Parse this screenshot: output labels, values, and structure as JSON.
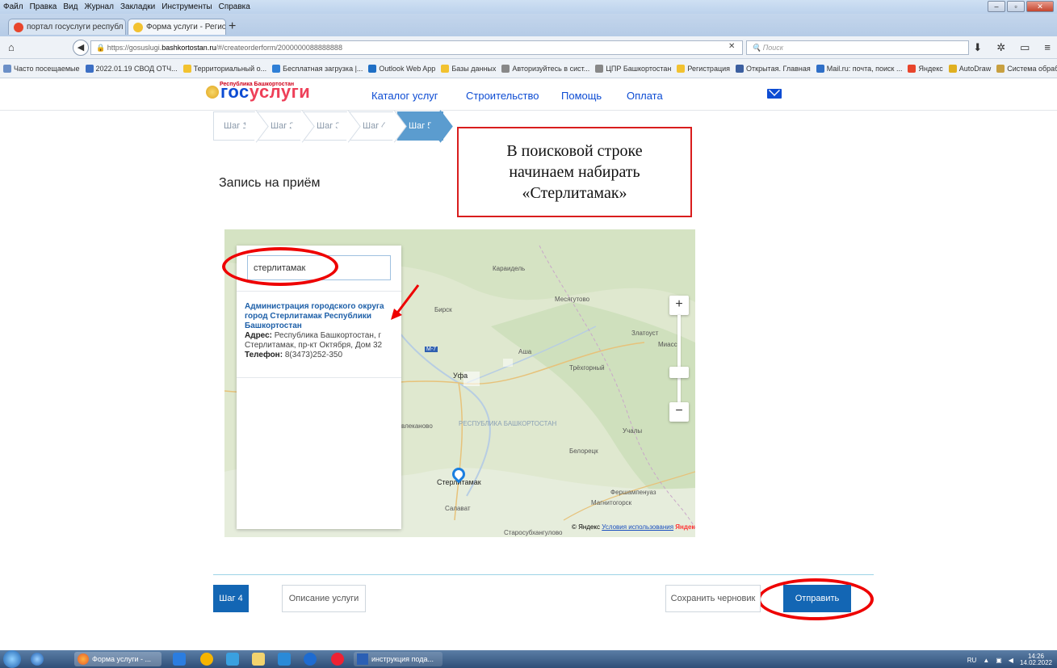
{
  "browser": {
    "menu": [
      "Файл",
      "Правка",
      "Вид",
      "Журнал",
      "Закладки",
      "Инструменты",
      "Справка"
    ],
    "tabs": [
      {
        "label": "портал госуслуги республ",
        "active": false,
        "favicon_color": "#e8452c"
      },
      {
        "label": "Форма услуги - Региональ",
        "active": true,
        "favicon_color": "#f2c230"
      }
    ],
    "url_prefix": "https://gosuslugi.",
    "url_domain": "bashkortostan.ru",
    "url_path": "/#/createorderform/2000000088888888",
    "search_placeholder": "Поиск",
    "bookmarks": [
      {
        "label": "Часто посещаемые",
        "color": "#6b8fc7"
      },
      {
        "label": "2022.01.19 СВОД ОТЧ...",
        "color": "#3c6fc4"
      },
      {
        "label": "Территориальный о...",
        "color": "#f2c230"
      },
      {
        "label": "Бесплатная загрузка |...",
        "color": "#2f7fd6"
      },
      {
        "label": "Outlook Web App",
        "color": "#1f6fc5"
      },
      {
        "label": "Базы данных",
        "color": "#f2c230"
      },
      {
        "label": "Авторизуйтесь в сист...",
        "color": "#888888"
      },
      {
        "label": "ЦПР Башкортостан",
        "color": "#888888"
      },
      {
        "label": "Регистрация",
        "color": "#f2c230"
      },
      {
        "label": "Открытая. Главная",
        "color": "#3b5fa0"
      },
      {
        "label": "Mail.ru: почта, поиск ...",
        "color": "#2f6fc7"
      },
      {
        "label": "Яндекс",
        "color": "#e8452c"
      },
      {
        "label": "AutoDraw",
        "color": "#e0b020"
      },
      {
        "label": "Система обработки з...",
        "color": "#c8a040"
      }
    ]
  },
  "site": {
    "logo_small": "Республика Башкортостан",
    "logo_main_a": "гос",
    "logo_main_b": "услуги",
    "nav": [
      "Каталог услуг",
      "Строительство",
      "Помощь",
      "Оплата"
    ],
    "steps": [
      "Шаг 1",
      "Шаг 2",
      "Шаг 3",
      "Шаг 4",
      "Шаг 5"
    ],
    "active_step": 5,
    "heading": "Запись на приём"
  },
  "callout": {
    "lines": [
      "В поисковой строке",
      "начинаем набирать",
      "«Стерлитамак»"
    ]
  },
  "map": {
    "search_value": "стерлитамак",
    "result_title": "Администрация городского округа город Стерлитамак Республики Башкортостан",
    "address_label": "Адрес:",
    "address_value": " Республика Башкортостан, г Стерлитамак, пр-кт Октября, Дом 32",
    "phone_label": "Телефон:",
    "phone_value": " 8(3473)252-350",
    "zoom_in": "+",
    "zoom_out": "−",
    "labels": {
      "karaidel": "Караидель",
      "mesyagutovo": "Месягутово",
      "birsk": "Бирск",
      "zlatoust": "Златоуст",
      "miass": "Миасс",
      "asha": "Аша",
      "trekhgorny": "Трёхгорный",
      "ufa": "Уфа",
      "m7": "M-7",
      "uchaly": "Учалы",
      "davlekanovo": "влеканово",
      "region": "РЕСПУБЛИКА БАШКОРТОСТАН",
      "beloretsk": "Белорецк",
      "sterlitamak": "Стерлитамак",
      "fershampenuaz": "Фершампенуаз",
      "magnitogorsk": "Магнитогорск",
      "salavat": "Салават",
      "starosubkhangulovo": "Старосубхангулово"
    },
    "copyright": "© Яндекс",
    "terms": "Условия использования",
    "yandex": "Яндекс"
  },
  "buttons": {
    "back_step": "Шаг 4",
    "service_description": "Описание услуги",
    "save_draft": "Сохранить черновик",
    "submit": "Отправить"
  },
  "taskbar": {
    "items": [
      "Форма услуги - ...",
      "инструкция пода..."
    ],
    "lang": "RU",
    "time": "14:26",
    "date": "14.02.2022"
  },
  "colors": {
    "gosuslugi_blue": "#0d4cd3",
    "step_active": "#5b9ccf",
    "primary_button": "#1366b4",
    "annotation_red": "#e00000"
  }
}
